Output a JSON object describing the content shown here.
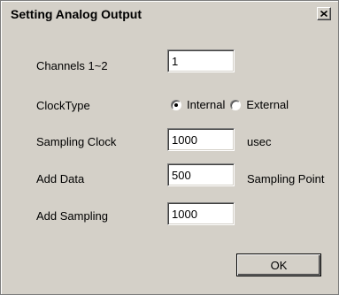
{
  "window": {
    "title": "Setting Analog Output",
    "close_icon": "close-icon"
  },
  "form": {
    "channels": {
      "label": "Channels  1~2",
      "value": "1"
    },
    "clock_type": {
      "label": "ClockType",
      "options": [
        {
          "label": "Internal",
          "checked": true
        },
        {
          "label": "External",
          "checked": false
        }
      ]
    },
    "sampling_clock": {
      "label": "Sampling Clock",
      "value": "1000",
      "unit": "usec"
    },
    "add_data": {
      "label": "Add Data",
      "value": "500",
      "unit": "Sampling Point"
    },
    "add_sampling": {
      "label": "Add Sampling",
      "value": "1000"
    }
  },
  "buttons": {
    "ok_label": "OK"
  }
}
